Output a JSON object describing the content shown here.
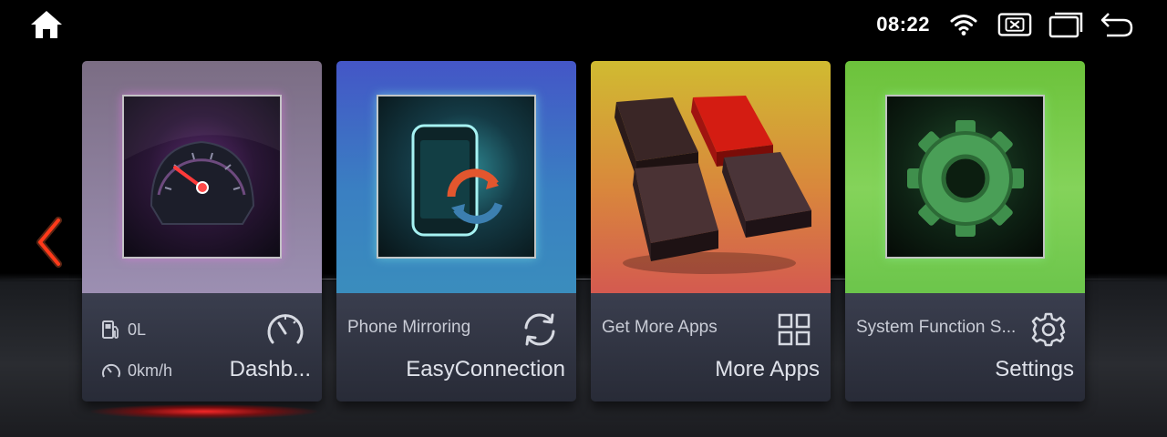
{
  "status_bar": {
    "time": "08:22",
    "icons": [
      "wifi-icon",
      "close-window-icon",
      "recent-apps-icon",
      "back-icon"
    ]
  },
  "nav": {
    "home_icon": "home-icon",
    "prev_icon": "chevron-left-icon"
  },
  "cards": [
    {
      "id": "dashboard",
      "fuel": "0L",
      "speed": "0km/h",
      "title": "Dashb...",
      "icon": "speedometer-icon"
    },
    {
      "id": "easyconnection",
      "subtitle": "Phone Mirroring",
      "title": "EasyConnection",
      "icon": "sync-icon"
    },
    {
      "id": "more-apps",
      "subtitle": "Get More Apps",
      "title": "More Apps",
      "icon": "grid-icon"
    },
    {
      "id": "settings",
      "subtitle": "System Function S...",
      "title": "Settings",
      "icon": "gear-icon"
    }
  ],
  "colors": {
    "accent_red": "#ff2a1a",
    "card_lower": "#30333f",
    "dashboard_top": "#8b7e9c",
    "easyconnection_top": "#3f6bc4",
    "more_apps_top": "#d6a03a",
    "settings_top": "#78cb4d"
  }
}
